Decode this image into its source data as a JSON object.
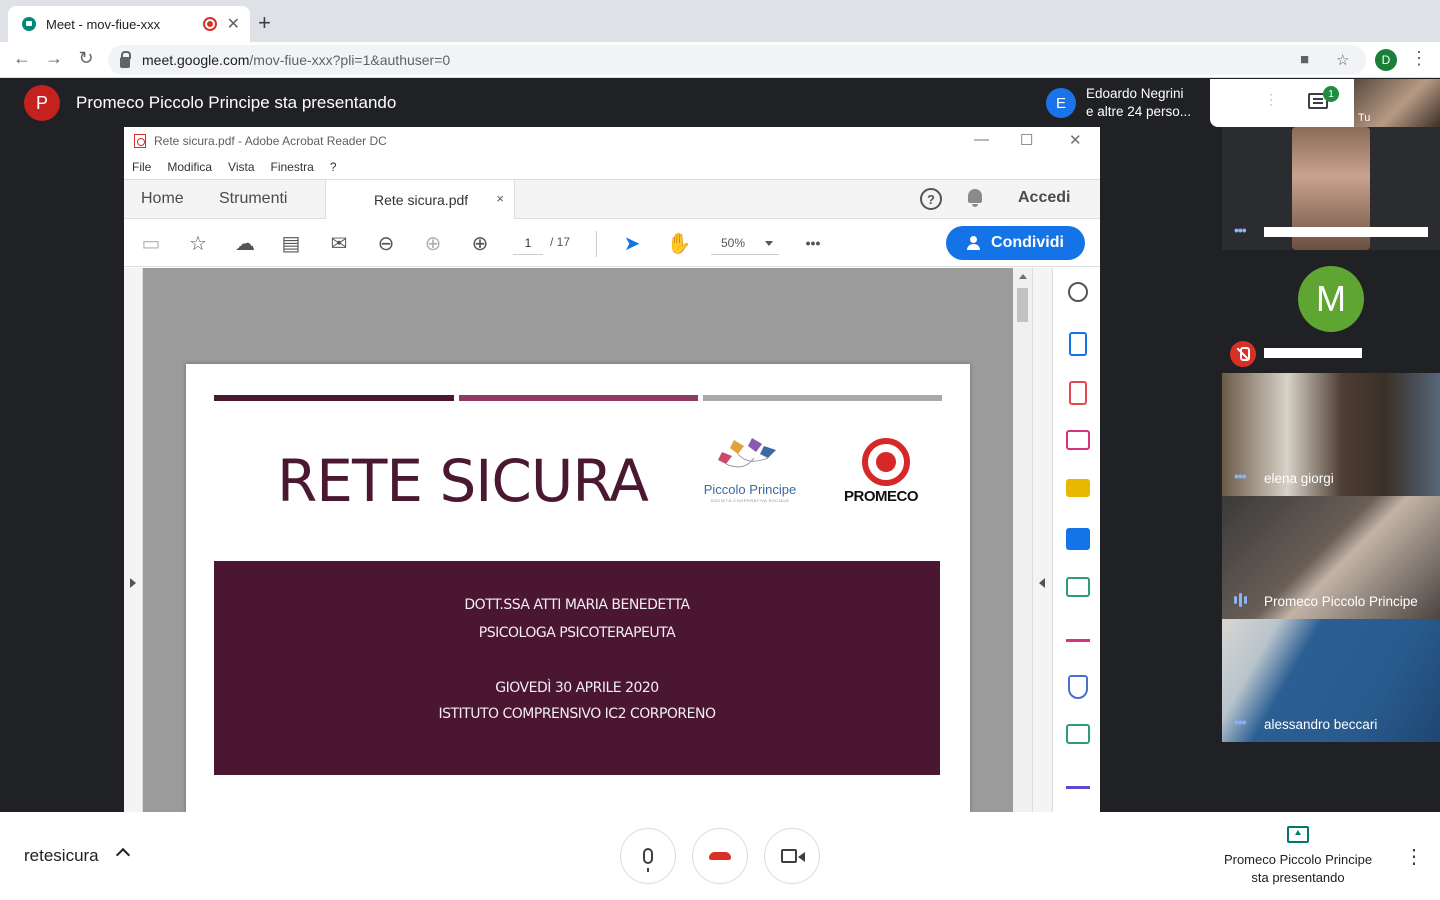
{
  "browser": {
    "tab_title": "Meet - mov-fiue-xxx",
    "tab_close": "✕",
    "new_tab": "+",
    "url_host": "meet.google.com",
    "url_path": "/mov-fiue-xxx?pli=1&authuser=0",
    "profile_initial": "D"
  },
  "meet_header": {
    "presenter_initial": "P",
    "presenting_text": "Promeco Piccolo Principe sta presentando",
    "participant_initial": "E",
    "participants_line1": "Edoardo Negrini",
    "participants_line2": "e altre 24 perso...",
    "chat_badge": "1",
    "self_label": "Tu"
  },
  "acrobat": {
    "window_title": "Rete sicura.pdf - Adobe Acrobat Reader DC",
    "menu": [
      "File",
      "Modifica",
      "Vista",
      "Finestra",
      "?"
    ],
    "tab_home": "Home",
    "tab_tools": "Strumenti",
    "doc_tab": "Rete sicura.pdf",
    "doc_tab_close": "×",
    "help": "?",
    "signin": "Accedi",
    "page_current": "1",
    "page_total": "/  17",
    "zoom": "50%",
    "more": "•••",
    "share": "Condividi"
  },
  "pdf": {
    "title": "RETE SICURA",
    "logo1_name": "Piccolo Principe",
    "logo1_sub": "SOCIETÀ COOPERATIVA SOCIALE",
    "logo2_name": "PROMECO",
    "line1": "DOTT.SSA ATTI MARIA BENEDETTA",
    "line2": "PSICOLOGA PSICOTERAPEUTA",
    "line3": "GIOVEDÌ 30 APRILE 2020",
    "line4": "ISTITUTO COMPRENSIVO IC2 CORPORENO",
    "colors": {
      "maroon": "#4a1632",
      "stripe1": "#4a1830",
      "stripe2": "#8e3a62",
      "stripe3": "#a7a9ac"
    }
  },
  "tiles": [
    {
      "name": ""
    },
    {
      "initial": "M",
      "name": ""
    },
    {
      "name": "elena giorgi"
    },
    {
      "name": "Promeco Piccolo Principe"
    },
    {
      "name": "alessandro beccari"
    }
  ],
  "bottom": {
    "meeting_name": "retesicura",
    "present_line1": "Promeco Piccolo Principe",
    "present_line2": "sta presentando"
  },
  "icons": {
    "more": "⋮",
    "tile_menu": "•••"
  }
}
